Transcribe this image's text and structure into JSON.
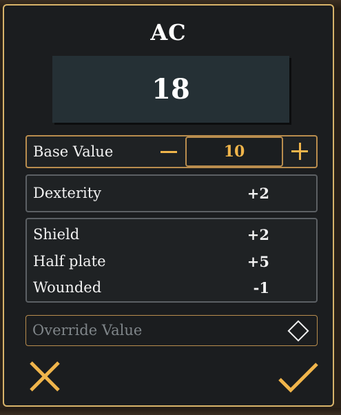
{
  "dialog": {
    "title": "AC",
    "total_value": "18"
  },
  "base": {
    "label": "Base Value",
    "value": "10",
    "minus_symbol": "−",
    "plus_symbol": "+"
  },
  "dexterity": {
    "label": "Dexterity",
    "value": "+2"
  },
  "modifiers": [
    {
      "label": "Shield",
      "value": "+2"
    },
    {
      "label": "Half plate",
      "value": "+5"
    },
    {
      "label": "Wounded",
      "value": "-1"
    }
  ],
  "override": {
    "label": "Override Value",
    "checked": false
  },
  "actions": {
    "cancel_icon": "close-icon",
    "confirm_icon": "check-icon"
  },
  "colors": {
    "accent": "#f0b54b",
    "border": "#d9b46a",
    "panel": "#1b1d1f",
    "value_box": "#253035"
  }
}
